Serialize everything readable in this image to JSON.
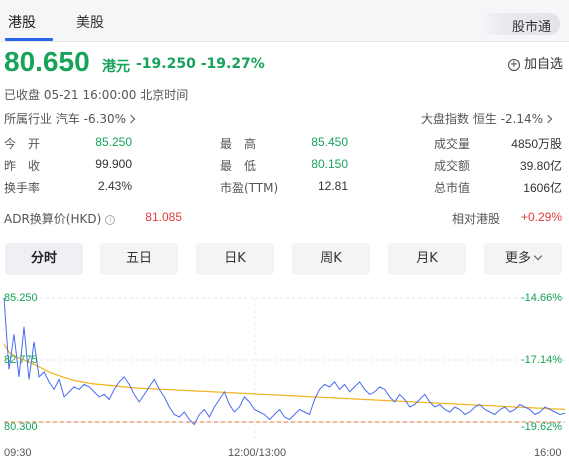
{
  "tabs": [
    {
      "label": "港股"
    },
    {
      "label": "美股"
    }
  ],
  "market_pill": "股市通",
  "quote": {
    "price": "80.650",
    "currency": "港元",
    "change": "-19.250 -19.27%",
    "add_fav": "加自选",
    "status": "已收盘  05-21 16:00:00  北京时间",
    "industry": "所属行业  汽车 -6.30%",
    "index": "大盘指数  恒生 -2.14%"
  },
  "stats": {
    "open_label": "今　开",
    "open": "85.250",
    "high_label": "最　高",
    "high": "85.450",
    "volume_label": "成交量",
    "volume": "4850万股",
    "prev_label": "昨　收",
    "prev": "99.900",
    "low_label": "最　低",
    "low": "80.150",
    "turnover_label": "成交额",
    "turnover": "39.80亿",
    "rate_label": "换手率",
    "rate": "2.43%",
    "pe_label": "市盈(TTM)",
    "pe": "12.81",
    "mcap_label": "总市值",
    "mcap": "1606亿"
  },
  "adr": {
    "label": "ADR换算价(HKD)",
    "value": "81.085",
    "rel_label": "相对港股",
    "rel_value": "+0.29%"
  },
  "periods": [
    "分时",
    "五日",
    "日K",
    "周K",
    "月K",
    "更多"
  ],
  "chart_data": {
    "type": "line",
    "y_left_ticks": [
      "85.250",
      "82.775",
      "80.300"
    ],
    "y_right_ticks": [
      "-14.66%",
      "-17.14%",
      "-19.62%"
    ],
    "x_ticks": [
      "09:30",
      "12:00/13:00",
      "16:00"
    ],
    "ylim": [
      80.3,
      85.25
    ],
    "reference_line": 80.3,
    "series": [
      {
        "values": [
          85.25,
          82.4,
          83.8,
          82.1,
          84.1,
          82.0,
          83.5,
          82.1,
          82.3,
          81.9,
          81.6,
          82.0,
          81.3,
          81.5,
          81.7,
          81.6,
          81.8,
          81.7,
          81.5,
          81.3,
          81.4,
          81.2,
          81.6,
          81.9,
          82.1,
          81.8,
          81.4,
          81.1,
          81.4,
          81.7,
          82.0,
          81.6,
          81.3,
          80.9,
          80.6,
          80.5,
          80.7,
          80.4,
          80.2,
          80.6,
          80.8,
          80.5,
          80.9,
          81.2,
          81.5,
          81.0,
          80.7,
          80.9,
          81.3,
          81.1,
          80.8,
          80.7,
          80.6,
          80.4,
          80.6,
          80.8,
          80.5,
          80.4,
          80.6,
          80.8,
          80.7,
          80.6,
          81.2,
          81.6,
          81.8,
          81.7,
          81.9,
          81.6,
          81.8,
          81.5,
          81.7,
          81.9,
          81.6,
          81.4,
          81.5,
          81.7,
          81.6,
          81.3,
          81.1,
          81.4,
          81.2,
          80.9,
          81.0,
          81.2,
          81.4,
          81.1,
          80.9,
          81.0,
          80.8,
          80.7,
          80.9,
          80.8,
          80.6,
          80.7,
          80.9,
          81.0,
          80.8,
          80.7,
          80.6,
          80.8,
          80.9,
          80.7,
          80.8,
          81.0,
          80.9,
          80.8,
          80.6,
          80.7,
          80.9,
          80.8,
          80.7,
          80.6,
          80.65
        ]
      },
      {
        "values": [
          83.4,
          83.1,
          82.95,
          82.85,
          82.78,
          82.7,
          82.6,
          82.5,
          82.4,
          82.3,
          82.22,
          82.15,
          82.08,
          82.02,
          81.96,
          81.92,
          81.88,
          81.85,
          81.82,
          81.8,
          81.78,
          81.76,
          81.74,
          81.72,
          81.7,
          81.68,
          81.66,
          81.65,
          81.64,
          81.63,
          81.62,
          81.61,
          81.6,
          81.59,
          81.58,
          81.57,
          81.56,
          81.55,
          81.54,
          81.53,
          81.52,
          81.51,
          81.5,
          81.49,
          81.48,
          81.47,
          81.46,
          81.45,
          81.44,
          81.43,
          81.42,
          81.41,
          81.4,
          81.39,
          81.38,
          81.37,
          81.36,
          81.35,
          81.34,
          81.33,
          81.32,
          81.31,
          81.3,
          81.29,
          81.28,
          81.27,
          81.26,
          81.25,
          81.24,
          81.23,
          81.22,
          81.21,
          81.2,
          81.19,
          81.18,
          81.17,
          81.16,
          81.15,
          81.14,
          81.13,
          81.12,
          81.11,
          81.1,
          81.09,
          81.08,
          81.07,
          81.06,
          81.05,
          81.04,
          81.03,
          81.02,
          81.01,
          81.0,
          80.99,
          80.98,
          80.97,
          80.96,
          80.95,
          80.94,
          80.93,
          80.92,
          80.91,
          80.9,
          80.89,
          80.88,
          80.87,
          80.86,
          80.85,
          80.84,
          80.83,
          80.82,
          80.81,
          80.8
        ]
      }
    ]
  },
  "colors": {
    "down": "#17a35a",
    "up": "#e23b3b",
    "price_line": "#4a6cf0",
    "avg_line": "#f2b21b",
    "ref_line": "#e8732e"
  }
}
